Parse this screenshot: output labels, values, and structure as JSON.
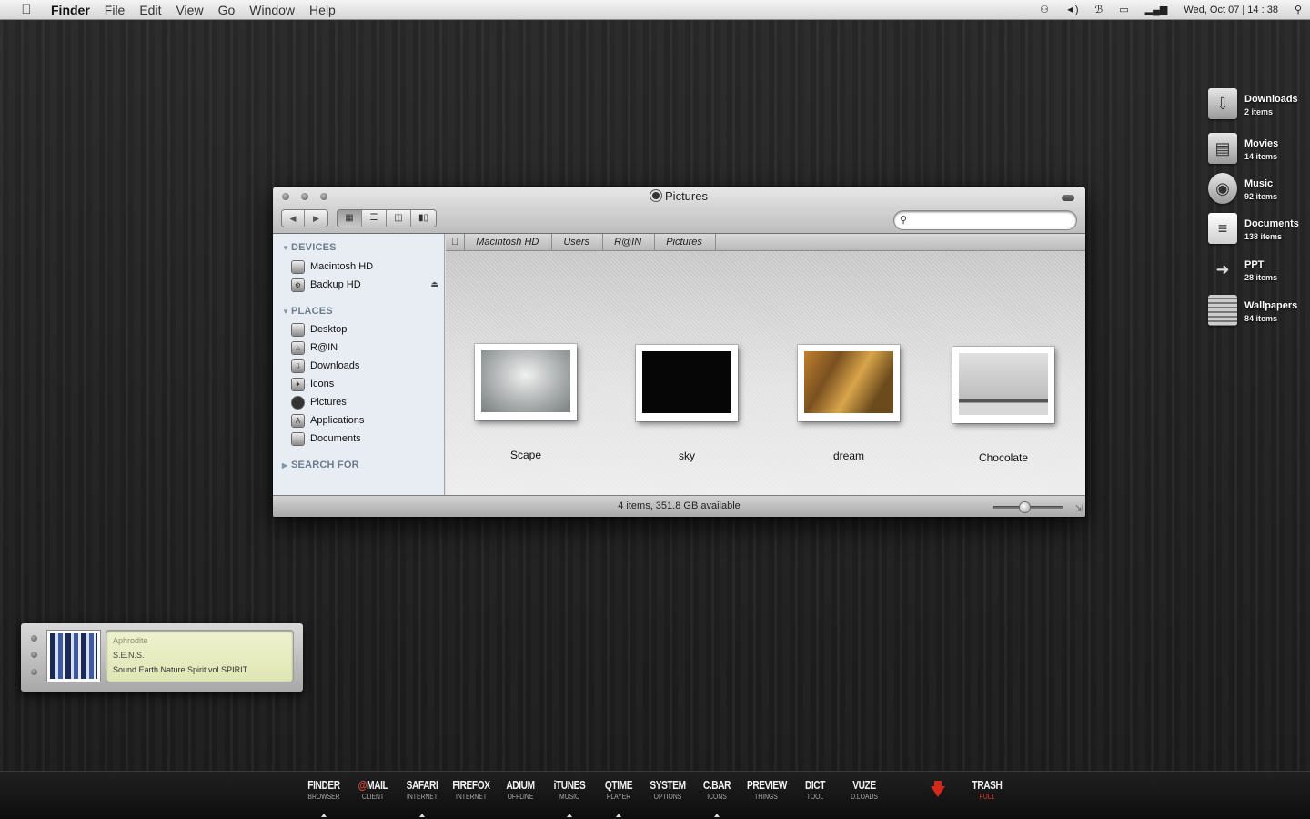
{
  "menubar": {
    "app_name": "Finder",
    "menus": [
      "File",
      "Edit",
      "View",
      "Go",
      "Window",
      "Help"
    ],
    "clock": "Wed, Oct  07 | 14 : 38"
  },
  "desktop_stacks": [
    {
      "name": "Downloads",
      "count": "2 items",
      "icon": "downloads-icon"
    },
    {
      "name": "Movies",
      "count": "14 items",
      "icon": "movies-icon"
    },
    {
      "name": "Music",
      "count": "92 items",
      "icon": "music-icon"
    },
    {
      "name": "Documents",
      "count": "138 items",
      "icon": "documents-icon"
    },
    {
      "name": "PPT",
      "count": "28 items",
      "icon": "ppt-icon"
    },
    {
      "name": "Wallpapers",
      "count": "84 items",
      "icon": "wallpapers-icon"
    }
  ],
  "finder": {
    "title": "Pictures",
    "search": {
      "placeholder": "",
      "value": ""
    },
    "sidebar": {
      "devices_header": "DEVICES",
      "devices": [
        "Macintosh HD",
        "Backup HD"
      ],
      "places_header": "PLACES",
      "places": [
        "Desktop",
        "R@IN",
        "Downloads",
        "Icons",
        "Pictures",
        "Applications",
        "Documents"
      ],
      "search_header": "SEARCH FOR"
    },
    "path": [
      "Macintosh HD",
      "Users",
      "R@IN",
      "Pictures"
    ],
    "items": [
      {
        "label": "Scape"
      },
      {
        "label": "sky"
      },
      {
        "label": "dream"
      },
      {
        "label": "Chocolate"
      }
    ],
    "status": "4 items, 351.8  GB available",
    "zoom_level": 0.45
  },
  "itunes_widget": {
    "artist": "Aphrodite",
    "title": "S.E.N.S.",
    "album": "Sound  Earth  Nature  Spirit  vol  SPIRIT"
  },
  "dock": [
    {
      "name": "FINDER",
      "sub": "BROWSER"
    },
    {
      "name": "@MAIL",
      "sub": "CLIENT"
    },
    {
      "name": "SAFARI",
      "sub": "INTERNET"
    },
    {
      "name": "FIREFOX",
      "sub": "INTERNET"
    },
    {
      "name": "ADIUM",
      "sub": "OFFLINE"
    },
    {
      "name": "iTUNES",
      "sub": "MUSIC"
    },
    {
      "name": "QTIME",
      "sub": "PLAYER"
    },
    {
      "name": "SYSTEM",
      "sub": "OPTIONS"
    },
    {
      "name": "C.BAR",
      "sub": "ICONS"
    },
    {
      "name": "PREVIEW",
      "sub": "THINGS"
    },
    {
      "name": "DICT",
      "sub": "TOOL"
    },
    {
      "name": "VUZE",
      "sub": "D.LOADS"
    },
    {
      "name": "TRASH",
      "sub": "FULL"
    }
  ]
}
